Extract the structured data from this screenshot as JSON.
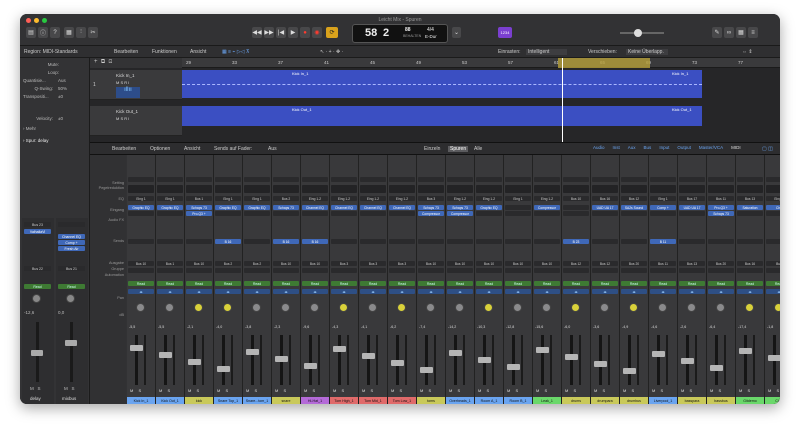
{
  "window": {
    "title": "Leicht Mix - Spuren"
  },
  "transport": {
    "bar": "58",
    "beat": "2",
    "tempo": "88",
    "tempo_label": "BEHALTEN",
    "signature": "4/4",
    "key": "E-Dur",
    "badge": "1234"
  },
  "toolbar2": {
    "edit": "Bearbeiten",
    "functions": "Funktionen",
    "view": "Ansicht",
    "snap_label": "Einrasten:",
    "snap_value": "Intelligent",
    "move_label": "Verschieben:",
    "move_value": "Keine Überlapp."
  },
  "inspector": {
    "region": "Region: MIDI-Standards",
    "mute": "Mute:",
    "loop": "Loop:",
    "quantize": "Quantisie...",
    "quantize_val": "Aus",
    "qswing": "Q-Swing:",
    "qswing_val": "50%",
    "transpose": "Transpositi...",
    "transpose_val": "±0",
    "velocity": "Velocity:",
    "velocity_val": "±0",
    "more": "Mehr",
    "track": "Spur: delay",
    "strip1": {
      "slot1": "Bus 23",
      "slot2": "ValhallaVi",
      "bus": "Bus 22",
      "read": "Read",
      "gain": "-12,6",
      "name": "delay",
      "mute": "M",
      "solo": "S"
    },
    "strip2": {
      "slot1": "Channel EQ",
      "slot2": "Comp +",
      "slot3": "Fresh Air",
      "bus": "Bus 21",
      "read": "Read",
      "gain": "0,0",
      "name": "mixbus",
      "mute": "M",
      "solo": "S"
    }
  },
  "ruler": [
    "29",
    "33",
    "37",
    "41",
    "45",
    "49",
    "53",
    "57",
    "61",
    "65",
    "69",
    "73",
    "77"
  ],
  "tracks": [
    {
      "num": "1",
      "name": "Kick In_1",
      "region": "Kick In_1",
      "region_end": "Kick In_1"
    },
    {
      "num": "",
      "name": "Kick Out_1",
      "region": "Kick Out_1",
      "region_end": "Kick Out_1"
    }
  ],
  "mixer": {
    "edit": "Bearbeiten",
    "options": "Optionen",
    "view": "Ansicht",
    "sends_label": "Sends auf Fader:",
    "sends_value": "Aus",
    "single": "Einzeln",
    "tracks": "Spuren",
    "all": "Alle",
    "tabs": [
      "Audio",
      "Inst",
      "Aux",
      "Bus",
      "Input",
      "Output",
      "Master/VCA",
      "MIDI"
    ],
    "row_labels": [
      "Setting",
      "Pegelreduktion",
      "EQ",
      "Eingang",
      "Audio FX",
      "Sends",
      "Ausgabe",
      "Gruppe",
      "Automation",
      "Pan",
      "dB"
    ],
    "strips": [
      {
        "name": "Kick In_1",
        "input": "Eing 1",
        "fx": "Graphic EQ",
        "fx2": "",
        "send": "",
        "out": "Bus 10",
        "gain": "-5,5",
        "color": "#6aa4f0"
      },
      {
        "name": "Kick Out_1",
        "input": "Eing 1",
        "fx": "Graphic EQ",
        "fx2": "",
        "send": "",
        "out": "Bus 1",
        "gain": "-5,5",
        "color": "#6aa4f0"
      },
      {
        "name": "kick",
        "input": "Bus 1",
        "fx": "Schaps 73",
        "fx2": "Pro-Q3 +",
        "send": "",
        "out": "Bus 10",
        "gain": "-2,1",
        "color": "#c9c95a"
      },
      {
        "name": "Snare Top_1",
        "input": "Eing 1",
        "fx": "Graphic EQ",
        "fx2": "",
        "send": "B 16",
        "out": "Bus 2",
        "gain": "-4,0",
        "color": "#6aa4f0"
      },
      {
        "name": "Snare...tom_1",
        "input": "Eing 1",
        "fx": "Graphic EQ",
        "fx2": "",
        "send": "",
        "out": "Bus 2",
        "gain": "-3,8",
        "color": "#6aa4f0"
      },
      {
        "name": "snare",
        "input": "Bus 2",
        "fx": "Schaps 73",
        "fx2": "",
        "send": "B 16",
        "out": "Bus 10",
        "gain": "-2,3",
        "color": "#c9c95a"
      },
      {
        "name": "Hi-Hat_1",
        "input": "Eing 1-2",
        "fx": "Channel EQ",
        "fx2": "",
        "send": "B 16",
        "out": "Bus 10",
        "gain": "-9,6",
        "color": "#b46ad8"
      },
      {
        "name": "Tom High_1",
        "input": "Eing 1-2",
        "fx": "Channel EQ",
        "fx2": "",
        "send": "",
        "out": "Bus 3",
        "gain": "-4,3",
        "color": "#e06a6a"
      },
      {
        "name": "Tom Mid_1",
        "input": "Eing 1-2",
        "fx": "Channel EQ",
        "fx2": "",
        "send": "",
        "out": "Bus 3",
        "gain": "-4,1",
        "color": "#e06a6a"
      },
      {
        "name": "Tom Low_1",
        "input": "Eing 1-2",
        "fx": "Channel EQ",
        "fx2": "",
        "send": "",
        "out": "Bus 3",
        "gain": "-6,2",
        "color": "#e06a6a"
      },
      {
        "name": "toms",
        "input": "Bus 3",
        "fx": "Schaps 73",
        "fx2": "Compressor",
        "send": "",
        "out": "Bus 10",
        "gain": "-7,4",
        "color": "#c9c95a"
      },
      {
        "name": "Overheads_1",
        "input": "Eing 1-2",
        "fx": "Schaps 73",
        "fx2": "Compressor",
        "send": "",
        "out": "Bus 10",
        "gain": "-14,2",
        "color": "#6aa4f0"
      },
      {
        "name": "Room A_1",
        "input": "Eing 1-2",
        "fx": "Graphic EQ",
        "fx2": "",
        "send": "",
        "out": "Bus 10",
        "gain": "-10,3",
        "color": "#6aa4f0"
      },
      {
        "name": "Room B_1",
        "input": "Eing 1",
        "fx": "",
        "fx2": "",
        "send": "",
        "out": "Bus 10",
        "gain": "-12,8",
        "color": "#6aa4f0"
      },
      {
        "name": "Leak_1",
        "input": "Eing 1-2",
        "fx": "Compressor",
        "fx2": "",
        "send": "",
        "out": "Bus 10",
        "gain": "-15,6",
        "color": "#6ad86a"
      },
      {
        "name": "drums",
        "input": "Bus 10",
        "fx": "",
        "fx2": "",
        "send": "B 23",
        "out": "Bus 12",
        "gain": "-6,0",
        "color": "#c9c95a"
      },
      {
        "name": "drumpara",
        "input": "Bus 16",
        "fx": "UAD UA 17",
        "fx2": "",
        "send": "",
        "out": "Bus 12",
        "gain": "-3,6",
        "color": "#c9c95a"
      },
      {
        "name": "drumbus",
        "input": "Bus 12",
        "fx": "SA2s Sound",
        "fx2": "",
        "send": "",
        "out": "Bus 20",
        "gain": "-4,9",
        "color": "#c9c95a"
      },
      {
        "name": "Liverpool_1",
        "input": "Eing 1",
        "fx": "Comp +",
        "fx2": "",
        "send": "B 11",
        "out": "Bus 11",
        "gain": "-4,6",
        "color": "#6aa4f0"
      },
      {
        "name": "basspara",
        "input": "Bus 17",
        "fx": "UAD UA 17",
        "fx2": "",
        "send": "",
        "out": "Bus 13",
        "gain": "-2,6",
        "color": "#c9c95a"
      },
      {
        "name": "bassbus",
        "input": "Bus 11",
        "fx": "Pro-Q3 +",
        "fx2": "Schaps 73",
        "send": "",
        "out": "Bus 20",
        "gain": "-6,4",
        "color": "#c9c95a"
      },
      {
        "name": "Gitdemo",
        "input": "Bus 13",
        "fx": "Saturation",
        "fx2": "",
        "send": "",
        "out": "Bus 16",
        "gain": "-17,4",
        "color": "#6ad86a"
      },
      {
        "name": "Clea",
        "input": "Eing 1",
        "fx": "Cha",
        "fx2": "",
        "send": "",
        "out": "Bus",
        "gain": "-1,8",
        "color": "#6ad86a"
      }
    ]
  }
}
